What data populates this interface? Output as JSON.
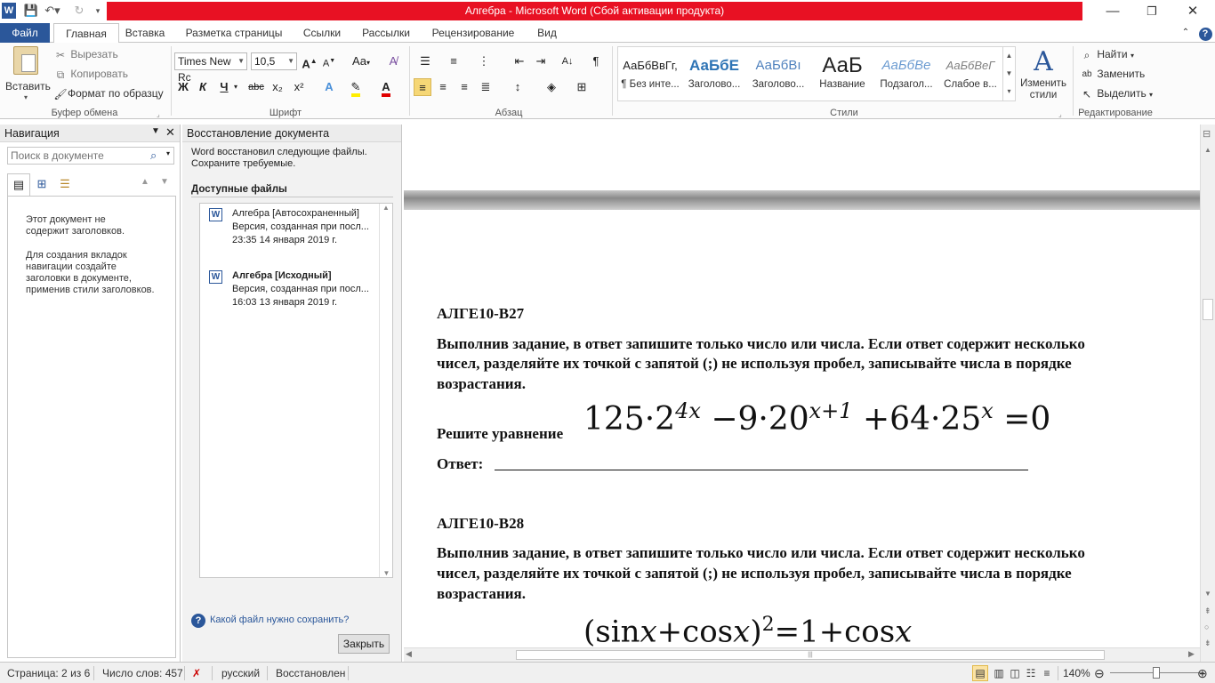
{
  "window": {
    "title": "Алгебра  -  Microsoft Word (Сбой активации продукта)",
    "controls": {
      "minimize": "—",
      "restore": "❐",
      "close": "✕"
    },
    "accent": "#e81123"
  },
  "tabs": [
    "Файл",
    "Главная",
    "Вставка",
    "Разметка страницы",
    "Ссылки",
    "Рассылки",
    "Рецензирование",
    "Вид"
  ],
  "ribbon": {
    "clipboard": {
      "paste": "Вставить",
      "cut": "Вырезать",
      "copy": "Копировать",
      "format_painter": "Формат по образцу",
      "label": "Буфер обмена"
    },
    "font": {
      "family": "Times New Rc",
      "size": "10,5",
      "bold": "Ж",
      "italic": "К",
      "underline": "Ч",
      "strike": "abc",
      "sub": "x₂",
      "sup": "x²",
      "grow": "A",
      "shrink": "A",
      "case": "Aa",
      "label": "Шрифт"
    },
    "paragraph": {
      "label": "Абзац"
    },
    "styles": {
      "items": [
        {
          "sample": "АаБбВвГг,",
          "name": "¶ Без инте..."
        },
        {
          "sample": "АаБбЕ",
          "name": "Заголово..."
        },
        {
          "sample": "АаБбВı",
          "name": "Заголово..."
        },
        {
          "sample": "АаБ",
          "name": "Название"
        },
        {
          "sample": "АаБбВе",
          "name": "Подзагол..."
        },
        {
          "sample": "АаБбВеГ",
          "name": "Слабое в..."
        }
      ],
      "change": "Изменить стили",
      "label": "Стили"
    },
    "editing": {
      "find": "Найти",
      "replace": "Заменить",
      "select": "Выделить",
      "label": "Редактирование"
    }
  },
  "nav_pane": {
    "title": "Навигация",
    "search_placeholder": "Поиск в документе",
    "msg1": "Этот документ не содержит заголовков.",
    "msg2": "Для создания вкладок навигации создайте заголовки в документе, применив стили заголовков."
  },
  "recovery_pane": {
    "title": "Восстановление документа",
    "intro": "Word восстановил следующие файлы. Сохраните требуемые.",
    "available": "Доступные файлы",
    "files": [
      {
        "name": "Алгебра  [Автосохраненный]",
        "desc": "Версия, созданная при посл...",
        "time": "23:35 14 января 2019 г."
      },
      {
        "name": "Алгебра  [Исходный]",
        "desc": "Версия, созданная при посл...",
        "time": "16:03 13 января 2019 г."
      }
    ],
    "help_link": "Какой файл нужно сохранить?",
    "close_button": "Закрыть"
  },
  "document": {
    "task1": {
      "code": "АЛГЕ10-В27",
      "instr_l1": "Выполнив задание, в ответ запишите только число или числа. Если ответ содержит несколько",
      "instr_l2": "чисел, разделяйте их точкой с запятой (;) не используя пробел, записывайте числа в порядке",
      "instr_l3": "возрастания.",
      "prompt": "Решите уравнение",
      "equation": "125·2^{4x} − 9·20^{x+1} + 64·25^{x} = 0",
      "answer_label": "Ответ:"
    },
    "task2": {
      "code": "АЛГЕ10-В28",
      "instr_l1": "Выполнив задание, в ответ запишите только число или числа. Если ответ содержит несколько",
      "instr_l2": "чисел, разделяйте их точкой с запятой (;) не используя пробел, записывайте числа в порядке",
      "instr_l3": "возрастания.",
      "equation": "(sin x + cos x)^2 = 1 + cos x"
    }
  },
  "status": {
    "page": "Страница: 2 из 6",
    "words": "Число слов: 457",
    "lang": "русский",
    "state": "Восстановлен",
    "zoom": "140%"
  }
}
